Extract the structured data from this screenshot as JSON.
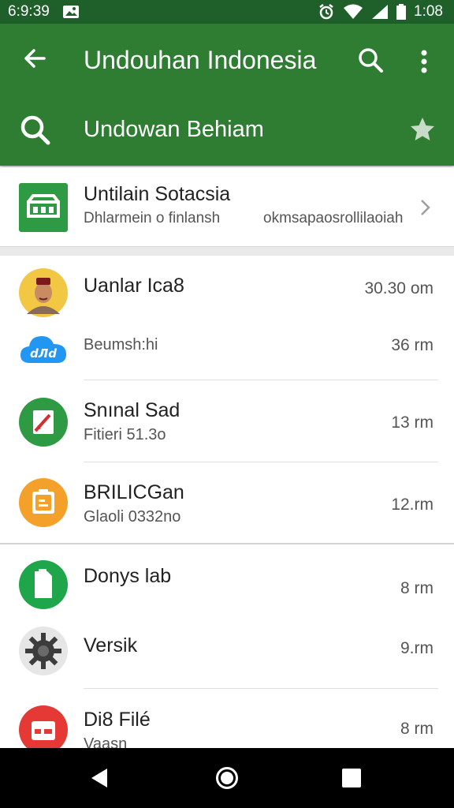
{
  "status_bar": {
    "time_left": "6:9:39",
    "time_right": "1:08",
    "icons": [
      "image-icon",
      "alarm-icon",
      "wifi-icon",
      "signal-icon",
      "battery-icon"
    ]
  },
  "app_bar": {
    "title": "Undouhan Indonesia",
    "subtitle": "Undowan Behiam",
    "icons": [
      "back-arrow-icon",
      "search-icon",
      "more-vert-icon",
      "search-icon",
      "star-icon"
    ],
    "background": "#2e7d32"
  },
  "featured": {
    "title": "Untilain Sotacsia",
    "subtitle": "Dhlarmein o finlansh",
    "detail": "okmsapaosrollilaoiah",
    "icon": "store-icon"
  },
  "list": {
    "items": [
      {
        "name": "Uanlar Ica8",
        "time": "30.30 om",
        "icon": "avatar"
      },
      {
        "sub": "Beumsh:hi",
        "time": "36 rm",
        "icon": "cloud-icon"
      },
      {
        "name": "Snınal Sad",
        "sub": "Fitieri 51.3o",
        "time": "13 rm",
        "icon": "edit-doc-icon"
      },
      {
        "name": "BRILICGan",
        "sub": "Glaoli 0332no",
        "time": "12.rm",
        "icon": "clipboard-icon"
      },
      {
        "name": "Donys lab",
        "time": "8 rm",
        "icon": "document-icon"
      },
      {
        "name": "Versik",
        "time": "9.rm",
        "icon": "gear-icon"
      },
      {
        "name": "Di8 Filé",
        "sub": "Vaasn",
        "time": "8 rm",
        "icon": "media-icon"
      }
    ]
  },
  "nav_bar": {
    "icons": [
      "nav-back-icon",
      "nav-home-icon",
      "nav-recents-icon"
    ]
  }
}
